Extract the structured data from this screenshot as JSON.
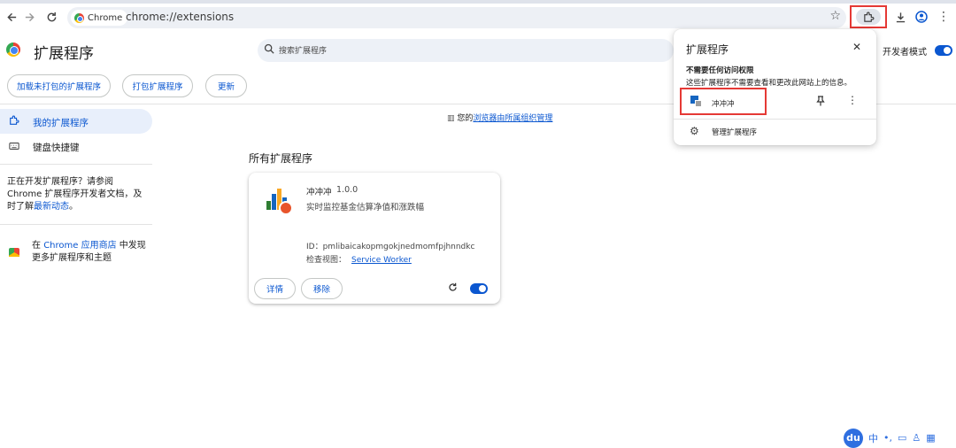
{
  "browser": {
    "chip_label": "Chrome",
    "url": "chrome://extensions",
    "nav_icons": [
      "back-icon",
      "forward-icon",
      "reload-icon"
    ],
    "right_icons": [
      "bookmark-star-icon",
      "extensions-puzzle-icon",
      "download-icon",
      "profile-icon",
      "more-vert-icon"
    ]
  },
  "page": {
    "title": "扩展程序",
    "search_placeholder": "搜索扩展程序",
    "dev_mode_label": "开发者模式",
    "dev_mode_on": true,
    "actions": {
      "load_unpacked": "加载未打包的扩展程序",
      "pack": "打包扩展程序",
      "update": "更新"
    }
  },
  "sidebar": {
    "items": [
      {
        "label": "我的扩展程序",
        "icon": "puzzle-icon",
        "selected": true
      },
      {
        "label": "键盘快捷键",
        "icon": "keyboard-icon",
        "selected": false
      }
    ],
    "dev_note_prefix": "正在开发扩展程序？请参阅 Chrome 扩展程序开发者文档，及时了解",
    "dev_note_link": "最新动态",
    "dev_note_suffix": "。",
    "store_prefix": "在 ",
    "store_link": "Chrome 应用商店",
    "store_suffix": " 中发现更多扩展程序和主题"
  },
  "main": {
    "managed_prefix": "您的",
    "managed_link": "浏览器由所属组织管理",
    "section_title": "所有扩展程序"
  },
  "extension_card": {
    "name": "冲冲冲",
    "version": "1.0.0",
    "description": "实时监控基金估算净值和涨跌幅",
    "id_label": "ID：pmlibaicakopmgokjnedmomfpjhnndkc",
    "inspect_label": "检查视图：",
    "inspect_link": "Service Worker",
    "details_button": "详情",
    "remove_button": "移除",
    "enabled": true,
    "icon_colors": [
      "#2e7d32",
      "#1565c0",
      "#f9a825",
      "#1565c0"
    ]
  },
  "popup": {
    "title": "扩展程序",
    "heading": "不需要任何访问权限",
    "subtext": "这些扩展程序不需要查看和更改此网站上的信息。",
    "item_name": "冲冲冲",
    "manage_label": "管理扩展程序"
  },
  "ime": {
    "logo": "du",
    "lang": "中",
    "icons": [
      "punct-icon",
      "screen-icon",
      "user-icon",
      "grid-icon"
    ]
  },
  "colors": {
    "accent": "#0b57d0",
    "highlight": "#e53935",
    "sidebar_selected": "#e8effb"
  }
}
